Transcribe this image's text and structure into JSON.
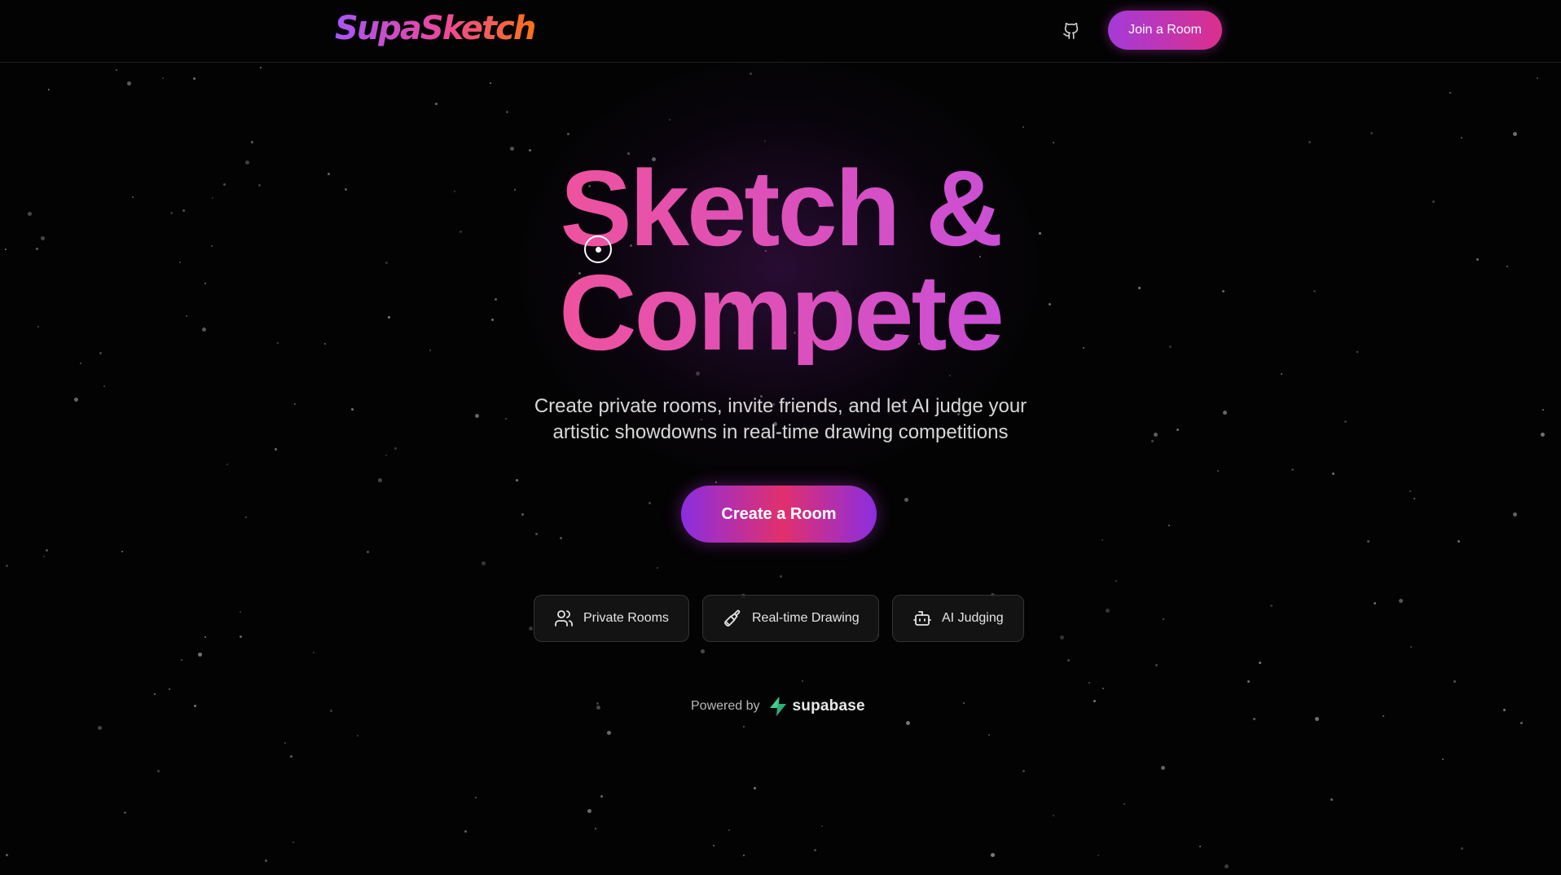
{
  "header": {
    "logo_text": "SupaSketch",
    "github_icon": "github-icon",
    "join_label": "Join a Room"
  },
  "hero": {
    "title_line1": "Sketch &",
    "title_line2": "Compete",
    "subtitle": "Create private rooms, invite friends, and let AI judge your artistic showdowns in real-time drawing competitions",
    "cta_label": "Create a Room"
  },
  "features": [
    {
      "label": "Private Rooms",
      "icon": "users-icon"
    },
    {
      "label": "Real-time Drawing",
      "icon": "paintbrush-icon"
    },
    {
      "label": "AI Judging",
      "icon": "bot-icon"
    }
  ],
  "footer": {
    "powered_label": "Powered by",
    "brand": "supabase",
    "brand_icon": "supabase-icon"
  },
  "colors": {
    "background": "#030303",
    "accent_pink": "#ec4899",
    "accent_purple": "#a855f7",
    "logo_orange": "#f97316",
    "supabase_green": "#3ecf8e"
  }
}
